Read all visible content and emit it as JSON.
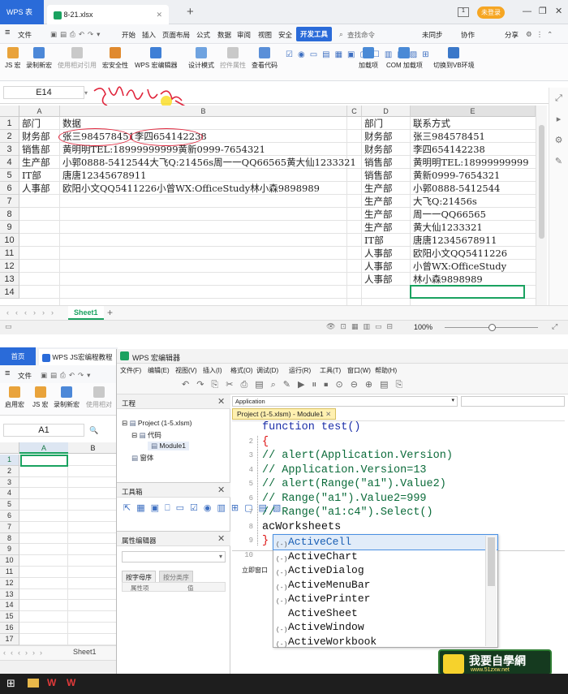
{
  "top": {
    "app_tab": "WPS 表格",
    "file_tab": "8-21.xlsx",
    "login": "未登录",
    "menus": [
      "文件",
      "开始",
      "插入",
      "页面布局",
      "公式",
      "数据",
      "审阅",
      "视图",
      "安全",
      "开发工具"
    ],
    "search": "查找命令",
    "sync": "未同步",
    "collab": "协作",
    "share": "分享",
    "ribbon": [
      "JS 宏",
      "录制新宏",
      "使用相对引用",
      "宏安全性",
      "WPS 宏编辑器",
      "设计模式",
      "控件属性",
      "查看代码",
      "加载项",
      "COM 加载项",
      "切换到VB环境"
    ],
    "namebox": "E14",
    "columns": [
      "A",
      "B",
      "C",
      "D",
      "E"
    ],
    "rows": [
      "1",
      "2",
      "3",
      "4",
      "5",
      "6",
      "7",
      "8",
      "9",
      "10",
      "11",
      "12",
      "13",
      "14"
    ],
    "colA": [
      "部门",
      "财务部",
      "销售部",
      "生产部",
      "IT部",
      "人事部"
    ],
    "colB": [
      "数据",
      "张三984578451李四654142238",
      "黄明明TEL:18999999999黄新0999-7654321",
      "小郭0888-5412544大飞Q:21456s周一一QQ66565黄大仙1233321",
      "唐唐12345678911",
      "欧阳小文QQ5411226小曾WX:OfficeStudy林小森9898989"
    ],
    "colD": [
      "部门",
      "财务部",
      "财务部",
      "销售部",
      "销售部",
      "生产部",
      "生产部",
      "生产部",
      "生产部",
      "IT部",
      "人事部",
      "人事部",
      "人事部"
    ],
    "colE": [
      "联系方式",
      "张三984578451",
      "李四654142238",
      "黄明明TEL:18999999999",
      "黄新0999-7654321",
      "小郭0888-5412544",
      "大飞Q:21456s",
      "周一一QQ66565",
      "黄大仙1233321",
      "唐唐12345678911",
      "欧阳小文QQ5411226",
      "小曾WX:OfficeStudy",
      "林小森9898989"
    ],
    "sheet": "Sheet1",
    "zoom": "100%"
  },
  "bottom": {
    "home_tab": "首页",
    "js_tab": "WPS JS宏编程教程",
    "editor_title": "WPS 宏编辑器",
    "menus": [
      "文件(F)",
      "编辑(E)",
      "视图(V)",
      "插入(I)",
      "格式(O)",
      "调试(D)",
      "运行(R)",
      "工具(T)",
      "窗口(W)",
      "帮助(H)"
    ],
    "left_menu": "文件",
    "left_ribbon": [
      "启用宏",
      "JS 宏",
      "录制新宏",
      "使用相对"
    ],
    "namebox": "A1",
    "cols": [
      "A",
      "B"
    ],
    "rows": [
      "1",
      "2",
      "3",
      "4",
      "5",
      "6",
      "7",
      "8",
      "9",
      "10",
      "11",
      "12",
      "13",
      "14",
      "15",
      "16",
      "17"
    ],
    "sheet": "Sheet1",
    "project_title": "工程",
    "project": "Project (1-5.xlsm)",
    "code_folder": "代码",
    "module": "Module1",
    "forms": "窗体",
    "toolbox": "工具箱",
    "props": "属性编辑器",
    "props_tabs": [
      "按字母序",
      "按分类序"
    ],
    "props_cols": [
      "属性项",
      "值"
    ],
    "obj_dropdown": "Application",
    "code_tab": "Project (1-5.xlsm) - Module1",
    "immediate": "立即窗口",
    "code_lines": [
      "function test()",
      "{",
      "//  alert(Application.Version)",
      "//  Application.Version=13",
      "//  alert(Range(\"a1\").Value2)",
      "//  Range(\"a1\").Value2=999",
      "//  Range(\"a1:c4\").Select()",
      "    acWorksheets",
      "}"
    ],
    "line_nums": [
      "2",
      "3",
      "4",
      "5",
      "6",
      "7",
      "8",
      "9",
      "10"
    ],
    "autocomplete": [
      "ActiveCell",
      "ActiveChart",
      "ActiveDialog",
      "ActiveMenuBar",
      "ActivePrinter",
      "ActiveSheet",
      "ActiveWindow",
      "ActiveWorkbook"
    ],
    "watermark": "我要自學網",
    "watermark_url": "www.51zxw.net"
  }
}
